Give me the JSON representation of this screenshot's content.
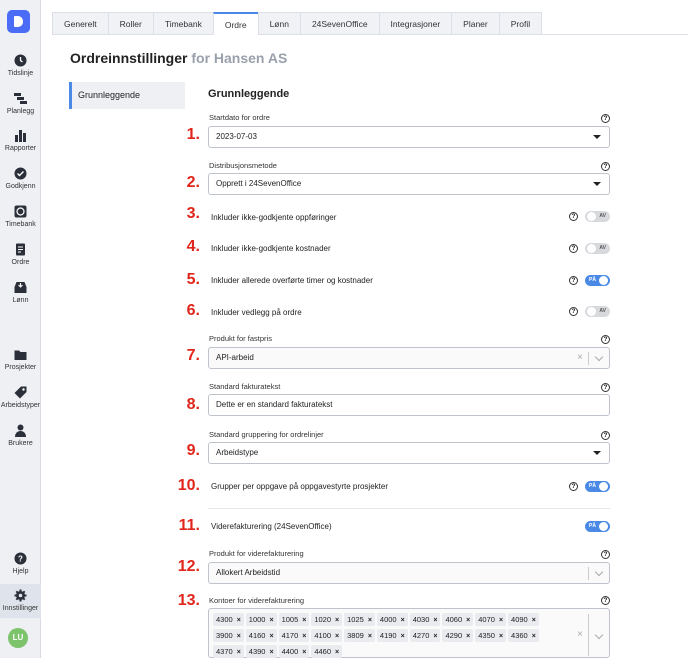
{
  "sidebar": {
    "items": [
      {
        "label": "Tidslinje",
        "icon": "clock-icon"
      },
      {
        "label": "Planlegg",
        "icon": "gantt-icon"
      },
      {
        "label": "Rapporter",
        "icon": "bar-chart-icon"
      },
      {
        "label": "Godkjenn",
        "icon": "check-circle-icon"
      },
      {
        "label": "Timebank",
        "icon": "timebank-icon"
      },
      {
        "label": "Ordre",
        "icon": "document-icon"
      },
      {
        "label": "Lønn",
        "icon": "inbox-icon"
      },
      {
        "label": "Prosjekter",
        "icon": "folder-icon"
      },
      {
        "label": "Arbeidstyper",
        "icon": "tag-icon"
      },
      {
        "label": "Brukere",
        "icon": "user-icon"
      },
      {
        "label": "Hjelp",
        "icon": "help-icon"
      },
      {
        "label": "Innstillinger",
        "icon": "gear-icon"
      }
    ],
    "avatar": "LU"
  },
  "tabs": [
    "Generelt",
    "Roller",
    "Timebank",
    "Ordre",
    "Lønn",
    "24SevenOffice",
    "Integrasjoner",
    "Planer",
    "Profil"
  ],
  "page": {
    "title": "Ordreinnstillinger",
    "subtitle": "for Hansen AS",
    "subnav": "Grunnleggende",
    "section_title": "Grunnleggende"
  },
  "settings": {
    "startdato": {
      "num": "1.",
      "label": "Startdato for ordre",
      "value": "2023-07-03"
    },
    "distribusjon": {
      "num": "2.",
      "label": "Distribusjonsmetode",
      "value": "Opprett i 24SevenOffice"
    },
    "ikke_godkjente_oppforinger": {
      "num": "3.",
      "label": "Inkluder ikke-godkjente oppføringer",
      "state": "AV"
    },
    "ikke_godkjente_kostnader": {
      "num": "4.",
      "label": "Inkluder ikke-godkjente kostnader",
      "state": "AV"
    },
    "allerede_overforte": {
      "num": "5.",
      "label": "Inkluder allerede overførte timer og kostnader",
      "state": "PÅ"
    },
    "vedlegg": {
      "num": "6.",
      "label": "Inkluder vedlegg på ordre",
      "state": "AV"
    },
    "produkt_fastpris": {
      "num": "7.",
      "label": "Produkt for fastpris",
      "value": "API-arbeid"
    },
    "fakturatekst": {
      "num": "8.",
      "label": "Standard fakturatekst",
      "value": "Dette er en standard fakturatekst"
    },
    "gruppering": {
      "num": "9.",
      "label": "Standard gruppering for ordrelinjer",
      "value": "Arbeidstype"
    },
    "grupper_oppgave": {
      "num": "10.",
      "label": "Grupper per oppgave på oppgavestyrte prosjekter",
      "state": "PÅ"
    },
    "viderefakturering": {
      "num": "11.",
      "label": "Viderefakturering (24SevenOffice)",
      "state": "PÅ"
    },
    "produkt_viderefakturering": {
      "num": "12.",
      "label": "Produkt for viderefakturering",
      "value": "Allokert Arbeidstid"
    },
    "kontoer": {
      "num": "13.",
      "label": "Kontoer for viderefakturering",
      "tags": [
        "4300",
        "1000",
        "1005",
        "1020",
        "1025",
        "4000",
        "4030",
        "4060",
        "4070",
        "4090",
        "3900",
        "4160",
        "4170",
        "4100",
        "3809",
        "4190",
        "4270",
        "4290",
        "4350",
        "4360",
        "4370",
        "4390",
        "4400",
        "4460"
      ]
    }
  },
  "colors": {
    "accent": "#4a8ae6",
    "number_red": "#e0251b",
    "sidebar_bg": "#eef0f4"
  }
}
